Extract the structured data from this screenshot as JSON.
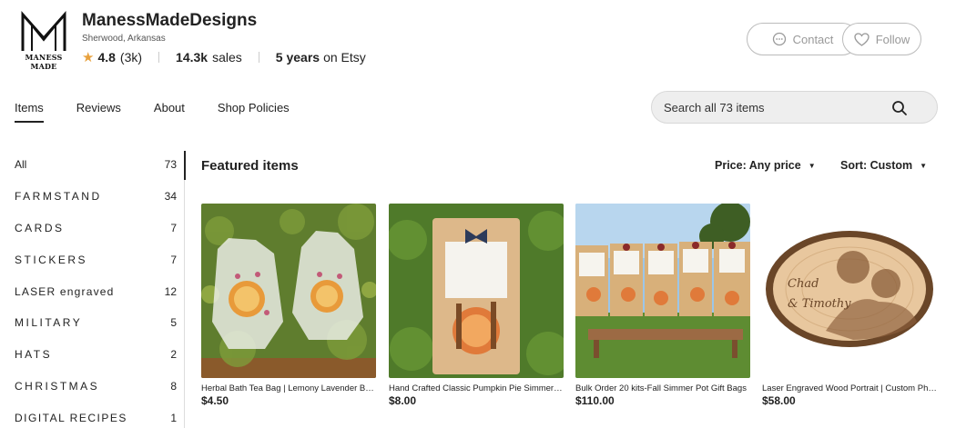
{
  "shop": {
    "logo_text": "MANESS MADE",
    "name": "ManessMadeDesigns",
    "location": "Sherwood, Arkansas",
    "rating": "4.8",
    "rating_count": "(3k)",
    "sales_value": "14.3k",
    "sales_label": "sales",
    "years_value": "5 years",
    "years_label": "on Etsy"
  },
  "actions": {
    "contact": "Contact",
    "follow": "Follow"
  },
  "nav": {
    "tabs": [
      "Items",
      "Reviews",
      "About",
      "Shop Policies"
    ],
    "active": "Items"
  },
  "search": {
    "placeholder": "Search all 73 items"
  },
  "sidebar": {
    "categories": [
      {
        "label": "All",
        "count": "73"
      },
      {
        "label": "FARMSTAND",
        "count": "34"
      },
      {
        "label": "CARDS",
        "count": "7"
      },
      {
        "label": "STICKERS",
        "count": "7"
      },
      {
        "label": "LASER engraved",
        "count": "12"
      },
      {
        "label": "MILITARY",
        "count": "5"
      },
      {
        "label": "HATS",
        "count": "2"
      },
      {
        "label": "CHRISTMAS",
        "count": "8"
      },
      {
        "label": "DIGITAL RECIPES",
        "count": "1"
      }
    ]
  },
  "main": {
    "heading": "Featured items",
    "price_filter": "Price: Any price",
    "sort_filter": "Sort: Custom",
    "items": [
      {
        "title": "Herbal Bath Tea Bag | Lemony Lavender Bath Soak",
        "price": "$4.50"
      },
      {
        "title": "Hand Crafted Classic Pumpkin Pie Simmer Pot",
        "price": "$8.00"
      },
      {
        "title": "Bulk Order 20 kits-Fall Simmer Pot Gift Bags",
        "price": "$110.00"
      },
      {
        "title": "Laser Engraved Wood Portrait | Custom Photo",
        "price": "$58.00"
      }
    ]
  },
  "colors": {
    "star": "#e8a13d",
    "text": "#222222",
    "search_bg": "#eeeeee"
  }
}
